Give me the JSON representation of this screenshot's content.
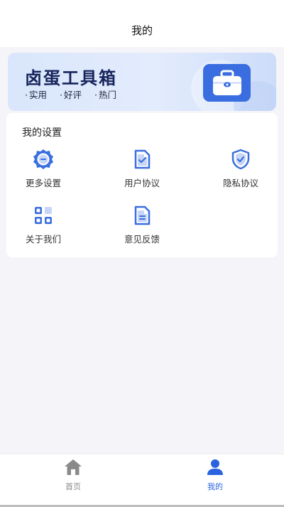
{
  "header": {
    "title": "我的"
  },
  "banner": {
    "brand": "卤蛋工具箱",
    "tags": [
      "实用",
      "好评",
      "热门"
    ]
  },
  "settings": {
    "title": "我的设置",
    "items": [
      {
        "label": "更多设置",
        "icon": "gear-icon"
      },
      {
        "label": "用户协议",
        "icon": "document-check-icon"
      },
      {
        "label": "隐私协议",
        "icon": "shield-check-icon"
      },
      {
        "label": "关于我们",
        "icon": "apps-grid-icon"
      },
      {
        "label": "意见反馈",
        "icon": "document-icon"
      }
    ]
  },
  "tabbar": {
    "tabs": [
      {
        "label": "首页",
        "icon": "home-icon",
        "active": false
      },
      {
        "label": "我的",
        "icon": "user-icon",
        "active": true
      }
    ]
  },
  "colors": {
    "accent": "#2a63e0",
    "icon_blue": "#3a6ee0",
    "background": "#f5f5f9"
  }
}
